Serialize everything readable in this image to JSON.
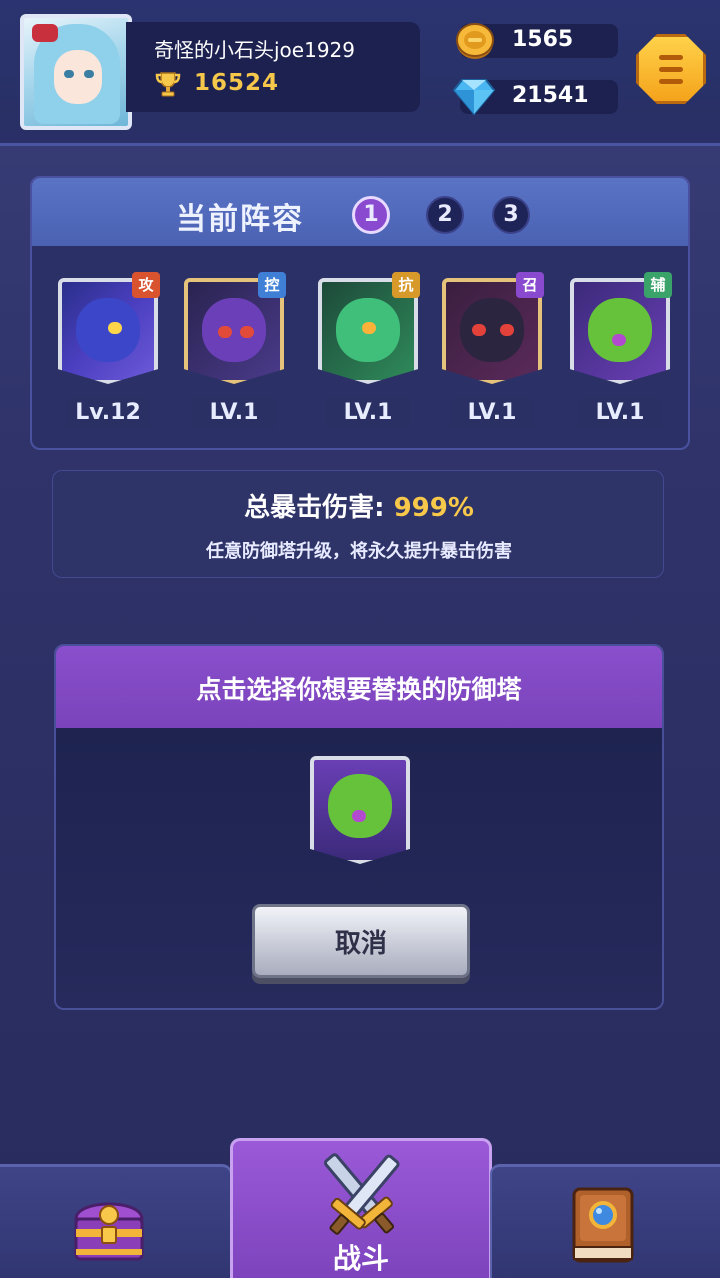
{
  "player": {
    "name": "奇怪的小石头joe1929",
    "trophies": "16524"
  },
  "resources": {
    "coins": "1565",
    "gems": "21541"
  },
  "lineup": {
    "title": "当前阵容",
    "tabs": [
      "1",
      "2",
      "3"
    ],
    "active_tab": "1",
    "heroes": [
      {
        "tag": "攻",
        "level": "Lv.12",
        "tag_color": "#d9532f"
      },
      {
        "tag": "控",
        "level": "LV.1",
        "tag_color": "#3f7fd6"
      },
      {
        "tag": "抗",
        "level": "LV.1",
        "tag_color": "#d79a2a"
      },
      {
        "tag": "召",
        "level": "LV.1",
        "tag_color": "#8a4ad0"
      },
      {
        "tag": "辅",
        "level": "LV.1",
        "tag_color": "#3aa36a"
      }
    ]
  },
  "crit": {
    "label": "总暴击伤害:",
    "value": "999%",
    "description": "任意防御塔升级，将永久提升暴击伤害"
  },
  "select": {
    "title": "点击选择你想要替换的防御塔",
    "cancel_label": "取消"
  },
  "nav": {
    "battle_label": "战斗",
    "icons": [
      "chest-icon",
      "crossed-swords-icon",
      "book-icon"
    ]
  },
  "colors": {
    "accent_gold": "#f7c84a",
    "purple": "#8a4fcc",
    "background": "#2f336a"
  }
}
